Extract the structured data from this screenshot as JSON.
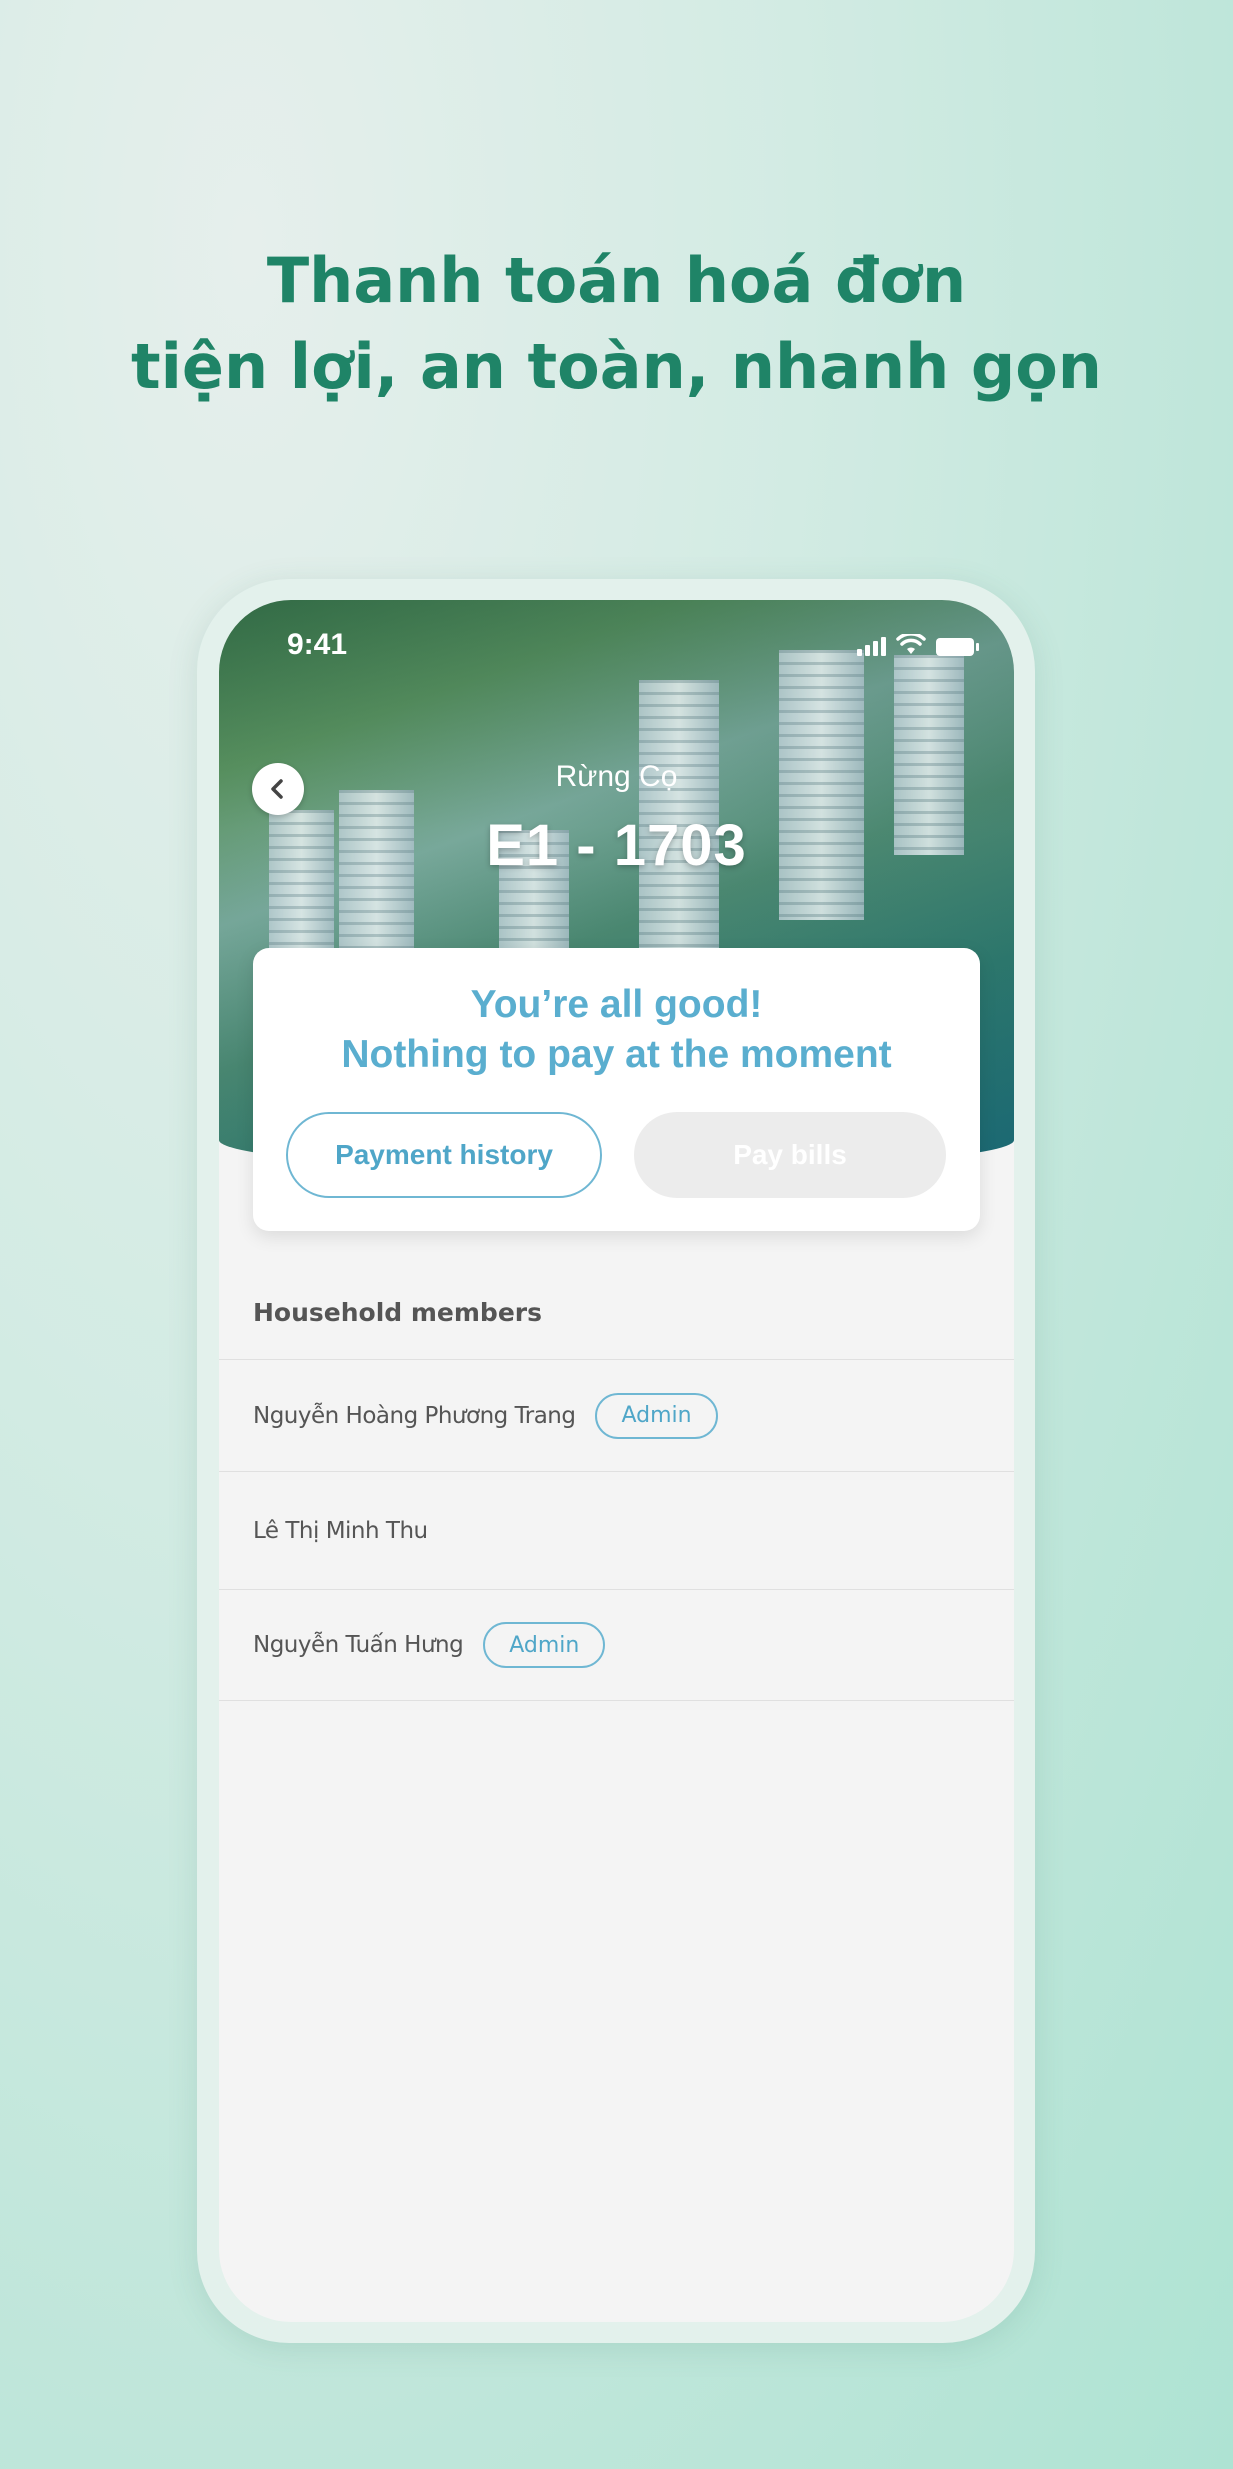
{
  "headline": {
    "line1": "Thanh toán hoá đơn",
    "line2": "tiện lợi, an toàn, nhanh gọn"
  },
  "status_bar": {
    "time": "9:41",
    "icons": [
      "signal-icon",
      "wifi-icon",
      "battery-icon"
    ]
  },
  "header": {
    "subtitle": "Rừng Cọ",
    "unit": "E1 - 1703",
    "back_icon": "chevron-left-icon"
  },
  "card": {
    "message_line1": "You’re all good!",
    "message_line2": "Nothing to pay at the moment",
    "history_button": "Payment history",
    "pay_button": "Pay bills"
  },
  "household": {
    "title": "Household members",
    "members": [
      {
        "name": "Nguyễn Hoàng Phương Trang",
        "badge": "Admin"
      },
      {
        "name": "Lê Thị Minh Thu",
        "badge": ""
      },
      {
        "name": "Nguyễn Tuấn Hưng",
        "badge": "Admin"
      }
    ]
  },
  "colors": {
    "headline": "#1f8467",
    "accent": "#5aaecf",
    "disabled_button": "#ececec"
  }
}
